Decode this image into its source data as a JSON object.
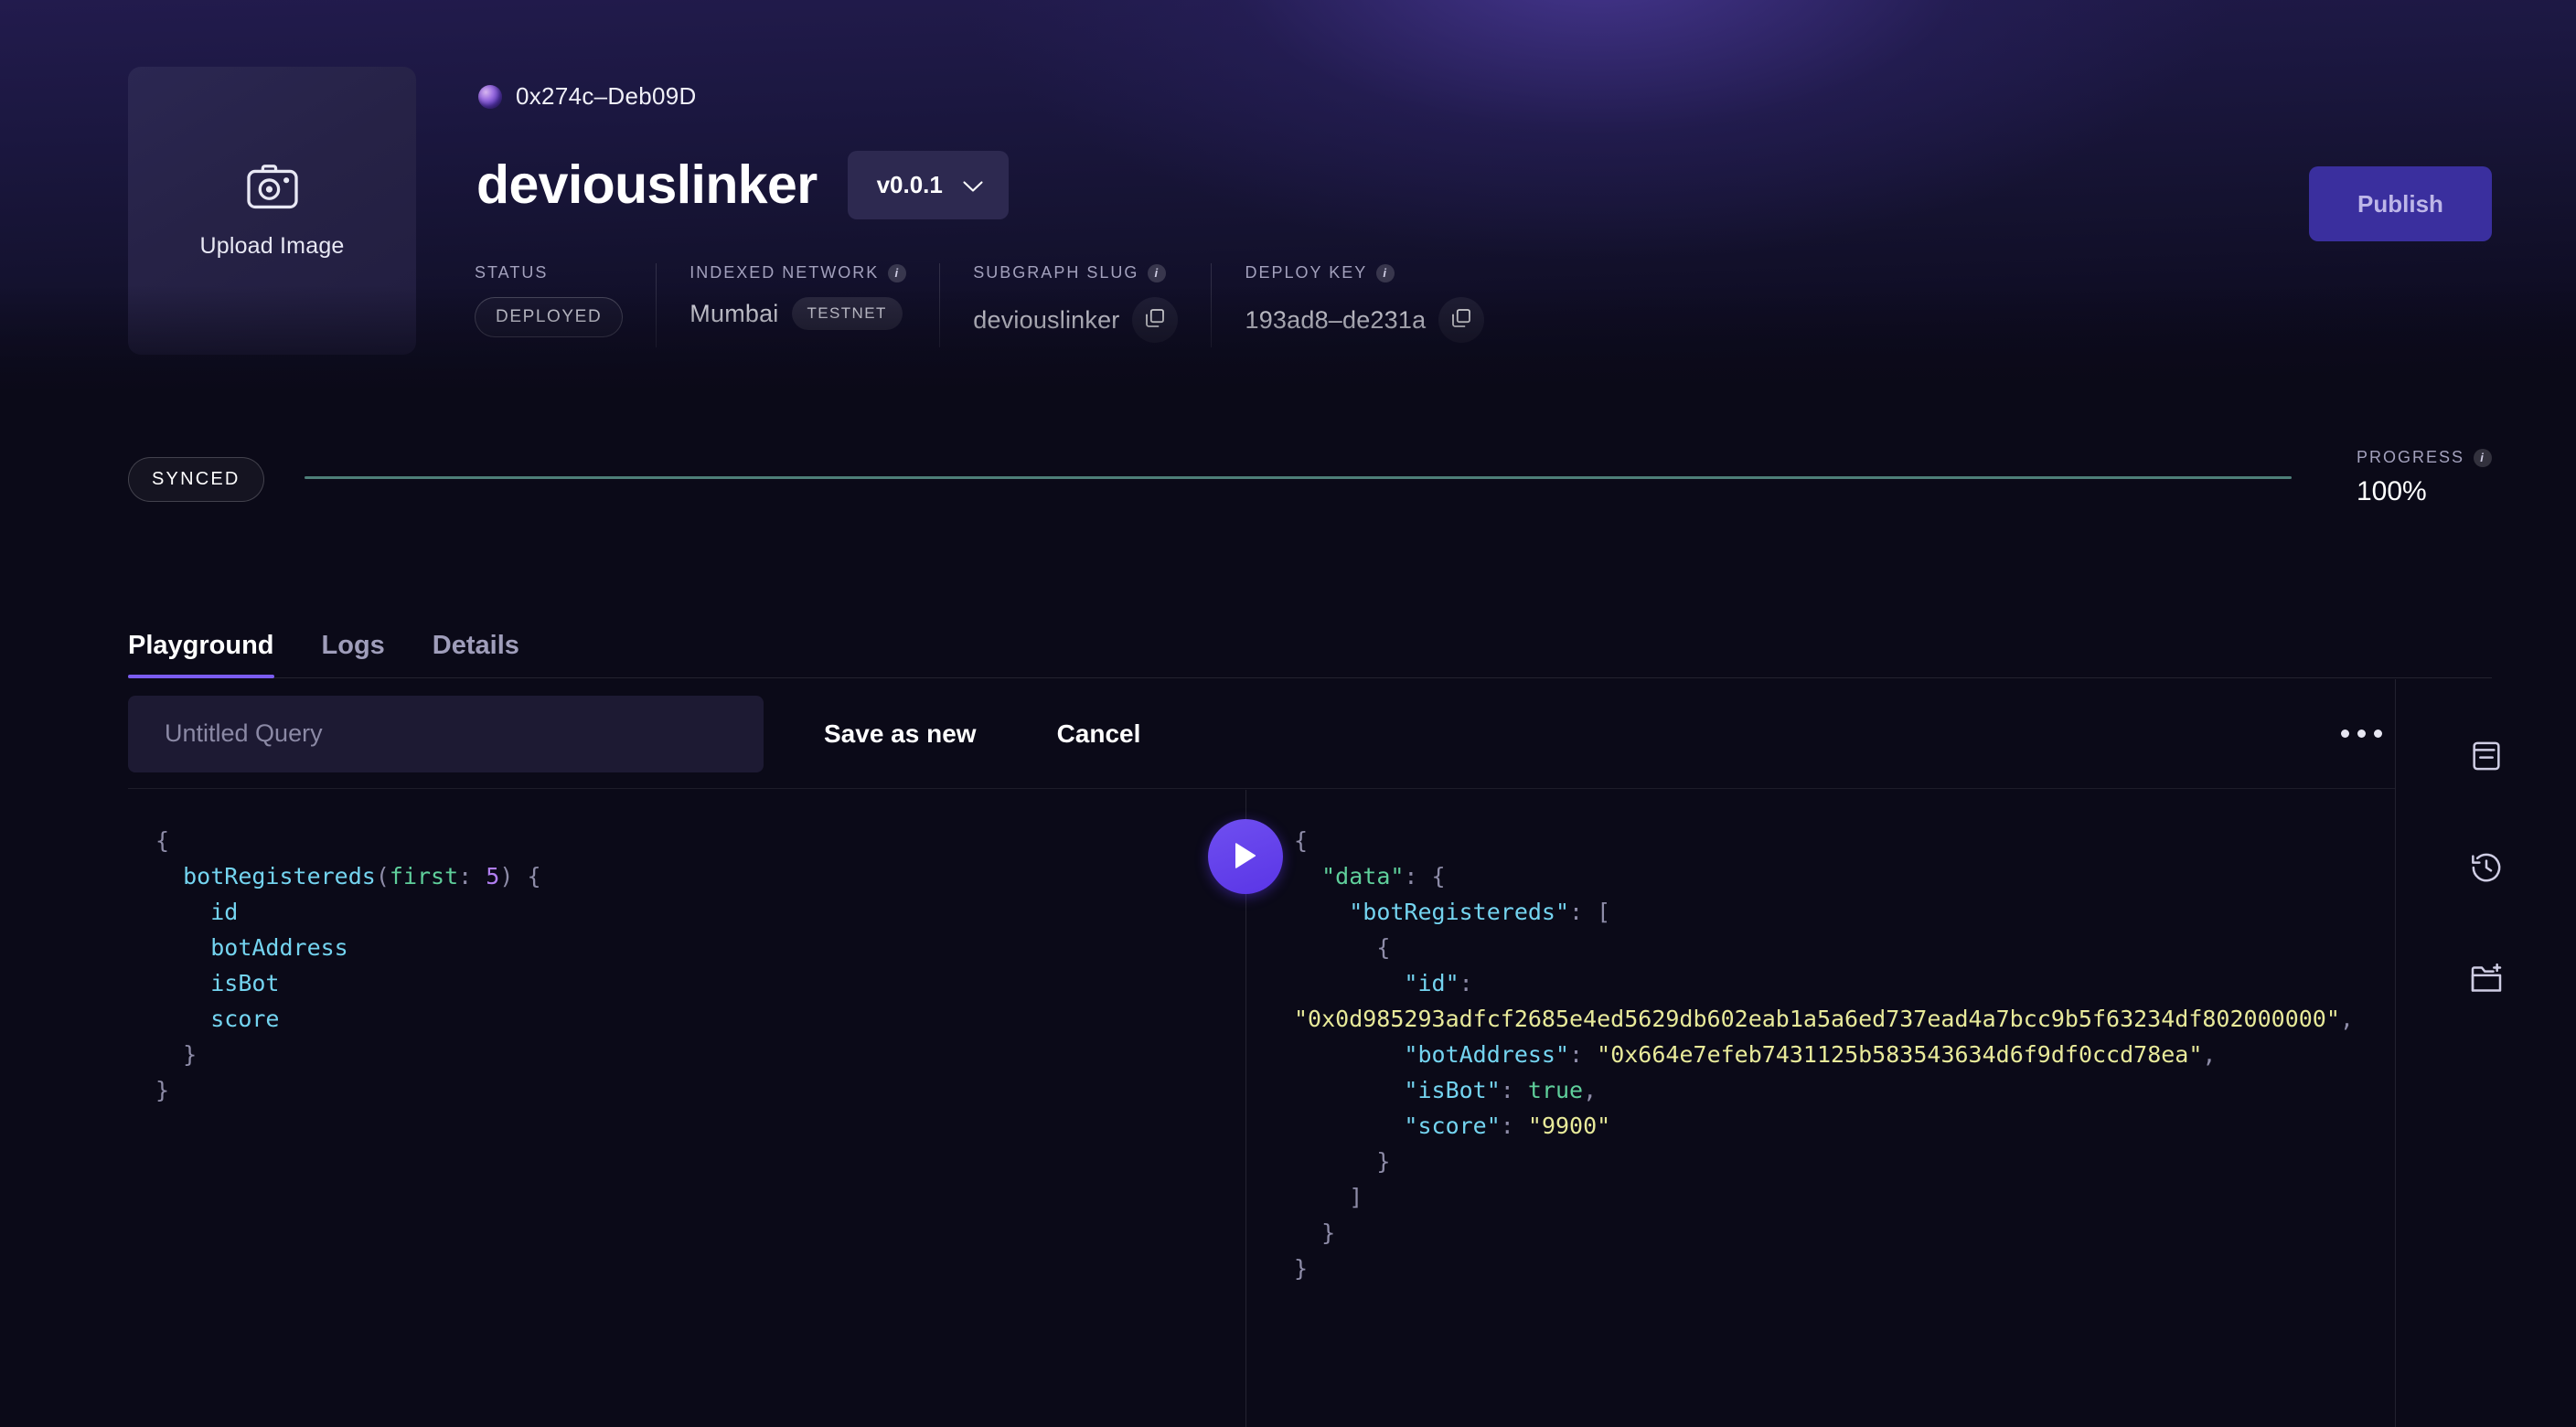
{
  "header": {
    "upload": {
      "label": "Upload Image",
      "icon": "camera-icon"
    },
    "owner_address": "0x274c–Deb09D",
    "subgraph_title": "deviouslinker",
    "version": "v0.0.1",
    "publish_label": "Publish",
    "meta": [
      {
        "label": "STATUS",
        "has_info": false,
        "value": "DEPLOYED",
        "kind": "pill"
      },
      {
        "label": "INDEXED NETWORK",
        "has_info": true,
        "value": "Mumbai",
        "badge": "TESTNET",
        "kind": "network"
      },
      {
        "label": "SUBGRAPH SLUG",
        "has_info": true,
        "value": "deviouslinker",
        "kind": "copy"
      },
      {
        "label": "DEPLOY KEY",
        "has_info": true,
        "value": "193ad8–de231a",
        "kind": "copy"
      }
    ]
  },
  "sync": {
    "status_label": "SYNCED",
    "progress_label": "PROGRESS",
    "progress_value": "100%",
    "progress_percent": 100,
    "bar_color": "#4e7f79"
  },
  "tabs": [
    {
      "label": "Playground",
      "active": true
    },
    {
      "label": "Logs",
      "active": false
    },
    {
      "label": "Details",
      "active": false
    }
  ],
  "toolbar": {
    "query_name_value": "",
    "query_name_placeholder": "Untitled Query",
    "save_label": "Save as new",
    "cancel_label": "Cancel",
    "more_label": "···"
  },
  "editor": {
    "query_lines": [
      {
        "parts": [
          {
            "t": "{",
            "c": "tok-punc"
          }
        ]
      },
      {
        "parts": [
          {
            "t": "  botRegistereds",
            "c": "tok-field"
          },
          {
            "t": "(",
            "c": "tok-punc"
          },
          {
            "t": "first",
            "c": "tok-arg"
          },
          {
            "t": ":",
            "c": "tok-punc"
          },
          {
            "t": " 5",
            "c": "tok-num"
          },
          {
            "t": ")",
            "c": "tok-punc"
          },
          {
            "t": " {",
            "c": "tok-punc"
          }
        ]
      },
      {
        "parts": [
          {
            "t": "    id",
            "c": "tok-field"
          }
        ]
      },
      {
        "parts": [
          {
            "t": "    botAddress",
            "c": "tok-field"
          }
        ]
      },
      {
        "parts": [
          {
            "t": "    isBot",
            "c": "tok-field"
          }
        ]
      },
      {
        "parts": [
          {
            "t": "    score",
            "c": "tok-field"
          }
        ]
      },
      {
        "parts": [
          {
            "t": "  }",
            "c": "tok-punc"
          }
        ]
      },
      {
        "parts": [
          {
            "t": "}",
            "c": "tok-punc"
          }
        ]
      }
    ],
    "result_lines": [
      {
        "parts": [
          {
            "t": "{",
            "c": "tok-punc"
          }
        ]
      },
      {
        "parts": [
          {
            "t": "  \"data\"",
            "c": "tok-dkey"
          },
          {
            "t": ": {",
            "c": "tok-punc"
          }
        ]
      },
      {
        "parts": [
          {
            "t": "    \"botRegistereds\"",
            "c": "tok-key"
          },
          {
            "t": ": [",
            "c": "tok-punc"
          }
        ]
      },
      {
        "parts": [
          {
            "t": "      {",
            "c": "tok-punc"
          }
        ]
      },
      {
        "parts": [
          {
            "t": "        \"id\"",
            "c": "tok-key"
          },
          {
            "t": ":",
            "c": "tok-punc"
          }
        ]
      },
      {
        "parts": [
          {
            "t": "\"0x0d985293adfcf2685e4ed5629db602eab1a5a6ed737ead4a7bcc9b5f63234df802000000\"",
            "c": "tok-str"
          },
          {
            "t": ",",
            "c": "tok-punc"
          }
        ]
      },
      {
        "parts": [
          {
            "t": "        \"botAddress\"",
            "c": "tok-key"
          },
          {
            "t": ": ",
            "c": "tok-punc"
          },
          {
            "t": "\"0x664e7efeb7431125b583543634d6f9df0ccd78ea\"",
            "c": "tok-str"
          },
          {
            "t": ",",
            "c": "tok-punc"
          }
        ]
      },
      {
        "parts": [
          {
            "t": "        \"isBot\"",
            "c": "tok-key"
          },
          {
            "t": ": ",
            "c": "tok-punc"
          },
          {
            "t": "true",
            "c": "tok-bool"
          },
          {
            "t": ",",
            "c": "tok-punc"
          }
        ]
      },
      {
        "parts": [
          {
            "t": "        \"score\"",
            "c": "tok-key"
          },
          {
            "t": ": ",
            "c": "tok-punc"
          },
          {
            "t": "\"9900\"",
            "c": "tok-str"
          }
        ]
      },
      {
        "parts": [
          {
            "t": "      }",
            "c": "tok-punc"
          }
        ]
      },
      {
        "parts": [
          {
            "t": "    ]",
            "c": "tok-punc"
          }
        ]
      },
      {
        "parts": [
          {
            "t": "  }",
            "c": "tok-punc"
          }
        ]
      },
      {
        "parts": [
          {
            "t": "}",
            "c": "tok-punc"
          }
        ]
      }
    ],
    "run_icon": "play-icon"
  },
  "rail": [
    {
      "icon": "docs-icon"
    },
    {
      "icon": "history-icon"
    },
    {
      "icon": "new-folder-icon"
    }
  ],
  "colors": {
    "accent_purple": "#7b5cf0",
    "publish_bg": "#3a2f9e",
    "progress_teal": "#4e7f79",
    "page_bg": "#0b0a18"
  }
}
